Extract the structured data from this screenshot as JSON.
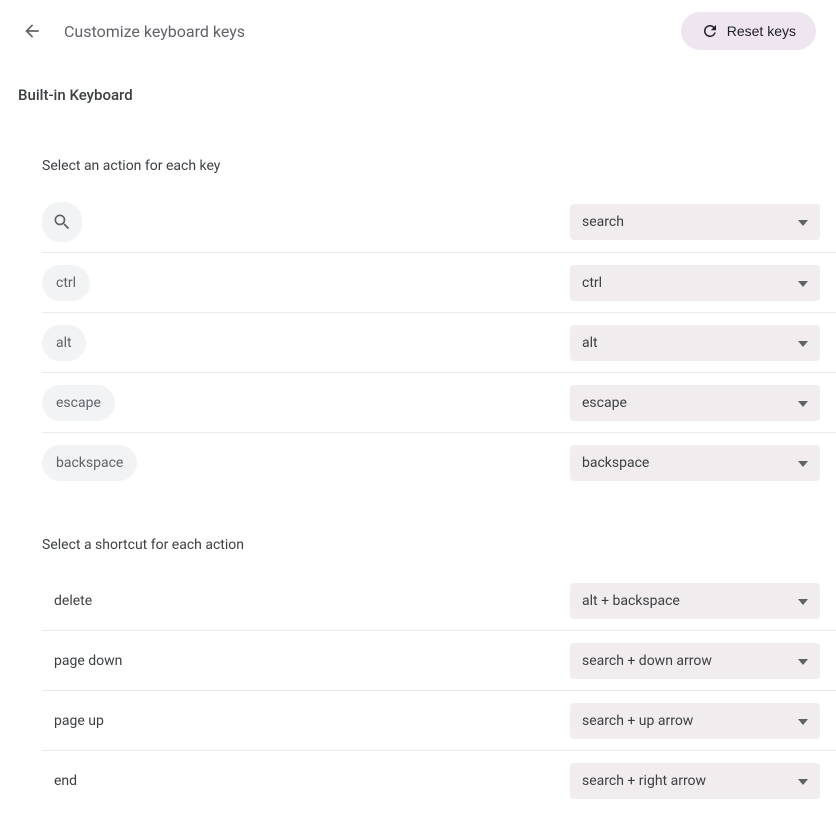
{
  "header": {
    "title": "Customize keyboard keys",
    "reset_label": "Reset keys"
  },
  "section": {
    "title": "Built-in Keyboard"
  },
  "keys_subheader": "Select an action for each key",
  "key_rows": [
    {
      "key_label": "",
      "is_icon": true,
      "icon": "search-icon",
      "value": "search"
    },
    {
      "key_label": "ctrl",
      "is_icon": false,
      "value": "ctrl"
    },
    {
      "key_label": "alt",
      "is_icon": false,
      "value": "alt"
    },
    {
      "key_label": "escape",
      "is_icon": false,
      "value": "escape"
    },
    {
      "key_label": "backspace",
      "is_icon": false,
      "value": "backspace"
    }
  ],
  "actions_subheader": "Select a shortcut for each action",
  "action_rows": [
    {
      "action_label": "delete",
      "value": "alt + backspace"
    },
    {
      "action_label": "page down",
      "value": "search + down arrow"
    },
    {
      "action_label": "page up",
      "value": "search + up arrow"
    },
    {
      "action_label": "end",
      "value": "search + right arrow"
    }
  ]
}
